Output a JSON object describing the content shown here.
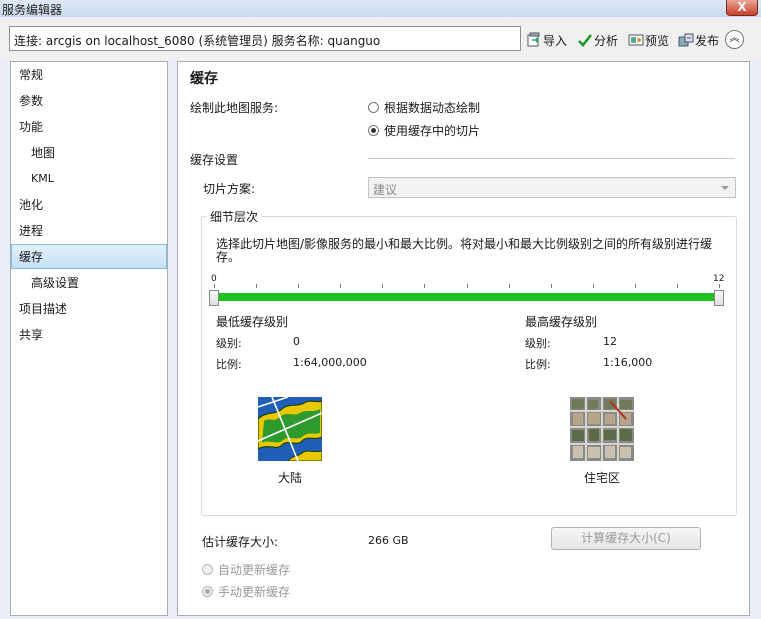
{
  "window": {
    "title": "服务编辑器",
    "close_glyph": "X"
  },
  "toolbar": {
    "connection": "连接: arcgis on localhost_6080 (系统管理员)   服务名称: quanguo",
    "import_label": "导入",
    "analyze_label": "分析",
    "preview_label": "预览",
    "publish_label": "发布",
    "collapse_glyph": "︽"
  },
  "sidebar": {
    "items": [
      {
        "label": "常规"
      },
      {
        "label": "参数"
      },
      {
        "label": "功能"
      },
      {
        "label": "地图"
      },
      {
        "label": "KML"
      },
      {
        "label": "池化"
      },
      {
        "label": "进程"
      },
      {
        "label": "缓存"
      },
      {
        "label": "高级设置"
      },
      {
        "label": "项目描述"
      },
      {
        "label": "共享"
      }
    ]
  },
  "panel": {
    "heading": "缓存",
    "draw_label": "绘制此地图服务:",
    "draw_options": [
      {
        "label": "根据数据动态绘制",
        "selected": false
      },
      {
        "label": "使用缓存中的切片",
        "selected": true
      }
    ],
    "cache_settings_label": "缓存设置",
    "tiling_scheme_label": "切片方案:",
    "tiling_scheme_value": "建议",
    "lod": {
      "legend": "细节层次",
      "description_line1": "选择此切片地图/影像服务的最小和最大比例。将对最小和最大比例级别之间的所有级别进行缓",
      "description_line2": "存。",
      "slider_min_label": "0",
      "slider_max_label": "12",
      "slider_min_value": 0,
      "slider_max_value": 12,
      "min": {
        "title": "最低缓存级别",
        "level_label": "级别:",
        "level": "0",
        "scale_label": "比例:",
        "scale": "1:64,000,000",
        "thumb_label": "大陆"
      },
      "max": {
        "title": "最高缓存级别",
        "level_label": "级别:",
        "level": "12",
        "scale_label": "比例:",
        "scale": "1:16,000",
        "thumb_label": "住宅区"
      }
    },
    "estimate_label": "估计缓存大小:",
    "estimate_value": "266 GB",
    "calc_button": "计算缓存大小(C)",
    "update_options": [
      {
        "label": "自动更新缓存",
        "selected": false
      },
      {
        "label": "手动更新缓存",
        "selected": true
      }
    ]
  },
  "colors": {
    "slider_fill": "#20c020",
    "selection_bg": "#c6e0f6"
  }
}
